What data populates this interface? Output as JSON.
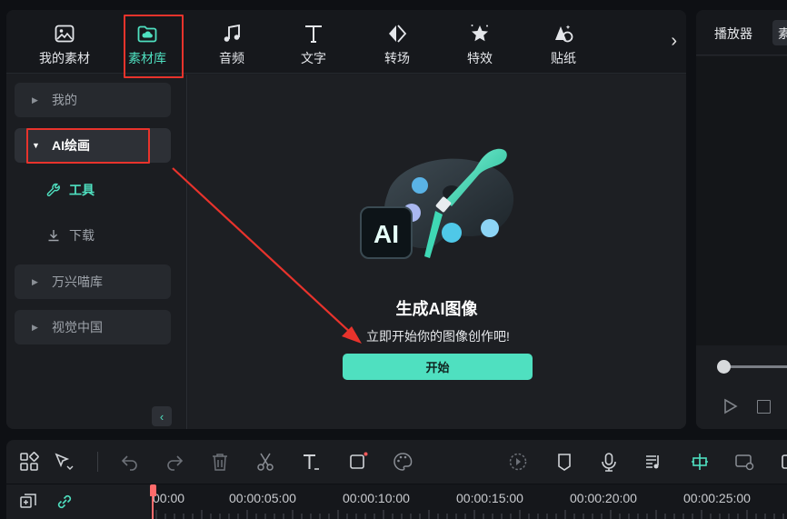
{
  "toolbar": {
    "tabs": [
      {
        "label": "我的素材",
        "icon": "image-icon"
      },
      {
        "label": "素材库",
        "icon": "cloud-folder-icon",
        "active": true
      },
      {
        "label": "音频",
        "icon": "music-note-icon"
      },
      {
        "label": "文字",
        "icon": "text-icon"
      },
      {
        "label": "转场",
        "icon": "transition-icon"
      },
      {
        "label": "特效",
        "icon": "sparkle-star-icon"
      },
      {
        "label": "贴纸",
        "icon": "sticker-icon"
      }
    ],
    "more": "›"
  },
  "sidebar": {
    "items": [
      {
        "label": "我的"
      },
      {
        "label": "AI绘画",
        "expanded": true
      },
      {
        "label": "万兴喵库"
      },
      {
        "label": "视觉中国"
      }
    ],
    "sub_items": [
      {
        "label": "工具",
        "icon": "wrench-icon",
        "active": true
      },
      {
        "label": "下载",
        "icon": "download-icon"
      }
    ],
    "collapse": "‹"
  },
  "main": {
    "art_badge": "AI",
    "title": "生成AI图像",
    "subtitle": "立即开始你的图像创作吧!",
    "start_button": "开始"
  },
  "player": {
    "tab": "播放器",
    "tab2": "素"
  },
  "timeline": {
    "ruler_labels": [
      "00:00",
      "00:00:05:00",
      "00:00:10:00",
      "00:00:15:00",
      "00:00:20:00",
      "00:00:25:00"
    ]
  },
  "colors": {
    "accent": "#4fe0c0",
    "highlight_box": "#e8332c",
    "playhead": "#ff6b6b",
    "panel_bg": "#1b1d21"
  }
}
